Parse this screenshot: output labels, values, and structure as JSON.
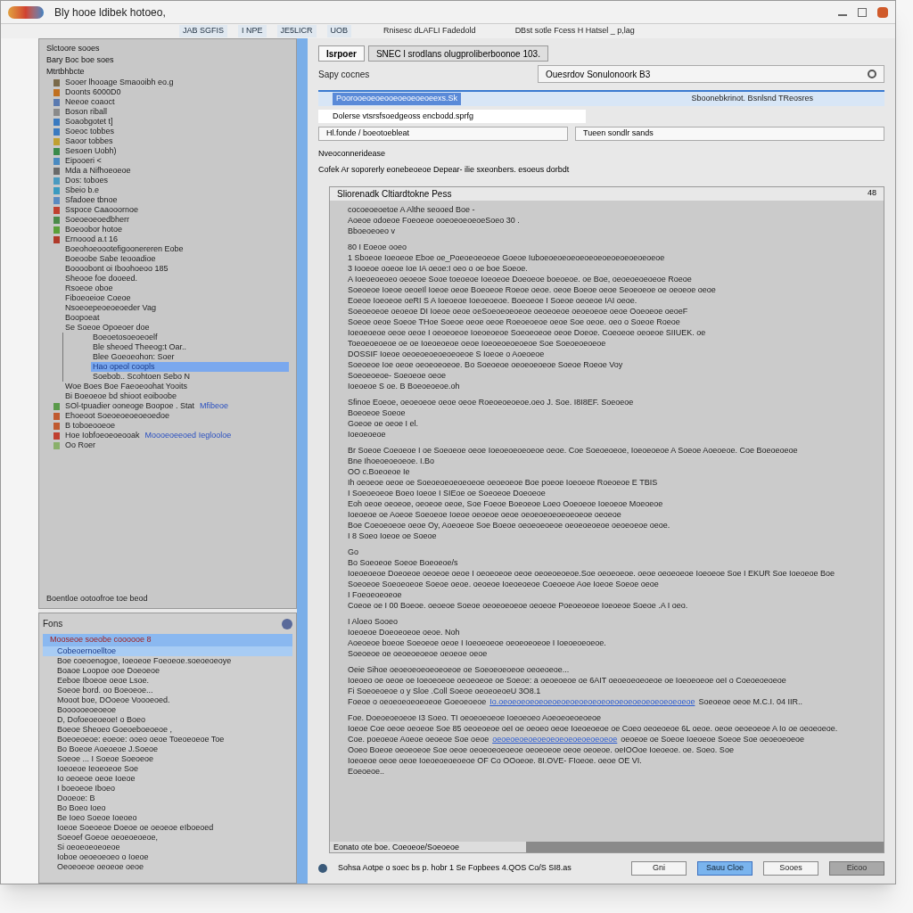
{
  "window": {
    "title": "Bly hooe ldibek hotoeo,"
  },
  "toolbar": {
    "items": [
      "JAB SGFIS",
      "I NPE",
      "JE5LICR",
      "UOB"
    ],
    "center_text": "Rnisesc dLAFLI Fadedold",
    "right_text": "DBst sotle Fcess H Hatsel _ p,lag"
  },
  "left_panel": {
    "header_lines": [
      "Slctoore sooes",
      "Bary Boc boe soes",
      "Mtrtbhbcte"
    ],
    "tree": [
      {
        "label": "Sooer lhooage Smaooibh eo.g",
        "color": "#7a6a4a",
        "selected": false
      },
      {
        "label": "Doonts 6000D0",
        "color": "#c07020",
        "selected": false
      },
      {
        "label": "Neeoe coaoct",
        "color": "#5a7ab0",
        "selected": false
      },
      {
        "label": "Boson riball",
        "color": "#8a8a8a",
        "selected": false
      },
      {
        "label": "Soaobgotet t]",
        "color": "#3a7ac0",
        "selected": false
      },
      {
        "label": "Soeoc tobbes",
        "color": "#3a7ac0",
        "selected": false
      },
      {
        "label": "Saoor tobbes",
        "color": "#c0a030",
        "selected": false
      },
      {
        "label": "Sesoen Uobh)",
        "color": "#3a8a4a",
        "selected": false
      },
      {
        "label": "Eipooeri <",
        "color": "#4a8ac0",
        "selected": false
      },
      {
        "label": "Mda a Nifhoeoeoe",
        "color": "#6a6a6a",
        "selected": false
      },
      {
        "label": "Dos: toboes",
        "color": "#4a9ac0",
        "selected": false
      },
      {
        "label": "Sbeio b.e",
        "color": "#3a9ac0",
        "selected": false
      },
      {
        "label": "Sfadoee tbnoe",
        "color": "#5a8ac0",
        "selected": false
      },
      {
        "label": "Sspoce Caaooornoe",
        "color": "#c04030",
        "selected": false
      },
      {
        "label": "Soeoeoeoedbherr",
        "color": "#4a8a4a",
        "selected": false
      },
      {
        "label": "Boeoobor hotoe",
        "color": "#5aa03a",
        "selected": false
      },
      {
        "label": "Ernoood a.t 16",
        "color": "#b03a2a",
        "selected": false
      },
      {
        "label": "Boeohoeoootefigoonereren Eobe",
        "selected": false
      },
      {
        "label": "Boeoobe Sabe Ieooadioe",
        "selected": false
      },
      {
        "label": "Boooobont oi Iboohoeoo 185",
        "selected": false
      },
      {
        "label": "Sheooe foe dooeed.",
        "selected": false
      },
      {
        "label": "Rsoeoe oboe",
        "selected": false
      },
      {
        "label": "Fiboeoeioe Coeoe",
        "selected": false
      },
      {
        "label": "Nsoeoepeoeoeoeder Vag",
        "selected": false
      },
      {
        "label": "Boopoeat",
        "selected": false
      },
      {
        "label": "Se Soeoe Opoeoer doe",
        "selected": false,
        "children": [
          {
            "label": "Boeoetosoeoeoelf",
            "selected": false
          },
          {
            "label": "Ble sheoed Theeog:t Oar..",
            "selected": false
          },
          {
            "label": "Blee Goeoeohon: Soer",
            "selected": false
          },
          {
            "label": "Hao opeol coopls",
            "selected": true
          },
          {
            "label": "Soebob.. Scohtoen Sebo N",
            "selected": false
          }
        ]
      },
      {
        "label": "Woe Boes Boe Faeoeoohat Yooits",
        "selected": false
      },
      {
        "label": "Bi Boeoeoe bd shioot eoiboobe",
        "selected": false
      },
      {
        "label": "SOl-tpuadier ooneoge Boopoe . Stat",
        "link": "Mfibeoe",
        "color": "#5a9a4a",
        "selected": false
      },
      {
        "label": "Ehoeoot Soeoeoeoeoeoedoe",
        "color": "#c05a30",
        "selected": false
      },
      {
        "label": "B toboeooeoe",
        "color": "#c05a30",
        "selected": false
      },
      {
        "label": "Hoe Iobfoeoeoeooak",
        "link": "Moooeoeeoed Ieglooloe",
        "color": "#c04030",
        "selected": false
      },
      {
        "label": "Oo Roer",
        "color": "#8ab06a",
        "selected": false
      }
    ],
    "footer": "Boentloe ootoofroe toe beod"
  },
  "bottom_panel": {
    "title": "Fons",
    "path": "Mooseoe soeobe coooooe 8",
    "items": [
      {
        "label": "Cobeoernoelltoe",
        "selected": true
      },
      {
        "label": "Boe coeoenogoe, Ioeoeoe Foeoeoe.soeoeoeoye",
        "selected": false
      },
      {
        "label": "Boaoe Loopoe ooe Doeoeoe",
        "selected": false
      },
      {
        "label": "Eeboe Iboeoe oeoe Lsoe.",
        "selected": false
      },
      {
        "label": "Soeoe bord. oo Boeoeoe...",
        "selected": false
      },
      {
        "label": "Mooot boe, DOoeoe Voooeoed.",
        "selected": false
      },
      {
        "label": "Boooooeoeoeoe",
        "selected": false
      },
      {
        "label": "D, Dofoeoeoeoe! o Boeo",
        "selected": false
      },
      {
        "label": "Boeoe Sheoeo Goeoeboeoeoe ,",
        "selected": false
      },
      {
        "label": "Boeoeoeoe: eoeoe: ooeo oeoe Toeoeoeoe Toe",
        "selected": false
      },
      {
        "label": "Bo Boeoe Aoeoeoe J.Soeoe",
        "selected": false
      },
      {
        "label": "Soeoe ... I Soeoe Soeoeoe",
        "selected": false
      },
      {
        "label": "Ioeoeoe Ieoeoeoe Soe",
        "selected": false
      },
      {
        "label": "Io oeoeoe oeoe Ioeoe",
        "selected": false
      },
      {
        "label": "I boeoeoe Iboeo",
        "selected": false
      },
      {
        "label": "Dooeoe: B",
        "selected": false
      },
      {
        "label": "Bo Boeo Ioeo",
        "selected": false
      },
      {
        "label": "Be Ioeo Soeoe Ioeoeo",
        "selected": false
      },
      {
        "label": "Ioeoe Soeoeoe Doeoe oe oeoeoe   eIboeoed",
        "selected": false
      },
      {
        "label": "Soeoef Goeoe oeoeoeoeoe,",
        "selected": false
      },
      {
        "label": "Si oeoeoeoeoeoe",
        "selected": false
      },
      {
        "label": "Ioboe oeoeoeoeo o Ioeoe",
        "selected": false
      },
      {
        "label": "Oeoeoeoe oeoeoe oeoe",
        "selected": false
      }
    ]
  },
  "main": {
    "tabs": [
      {
        "label": "Isrpoer",
        "selected": true
      },
      {
        "label": "SNEC l srodlans olugproliberboonoe 103.",
        "selected": false
      }
    ],
    "subtitle": "Sapy cocnes",
    "search": {
      "value": "Ouesrdov Sonulonoork B3"
    },
    "header_bar": {
      "left": "Poorooeoeoeooeoeoeoeoeexs.Sk",
      "right": "Sboonebkrinot. Bsnlsnd TReosres"
    },
    "info_row": "Dolerse vtsrsfsoedgeoss encbodd.sprfg",
    "path_field": {
      "value": "Hl.fonde / boeotoebleat"
    },
    "combo": {
      "value": "Tueen sondlr sands"
    },
    "note": "Nveoconneridease",
    "description": "Cofek Ar soporerly eonebeoeoe Depear- ilie sxeonbers. esoeus dorbdt",
    "content": {
      "title": "Sliorenadk Cltiardtokne Pess",
      "corner": "48",
      "blocks": [
        {
          "lines": [
            {
              "text": "cocoeoeoetoe A Althe seooed Boe -"
            },
            {
              "text": "Aoeoe odoeoe Foeoeoe ooeoeoeoeoeSoeo 30 ."
            },
            {
              "text": "Bboeoeoeo v"
            }
          ]
        },
        {
          "lines": [
            {
              "text": "80 I Eoeoe ooeo"
            },
            {
              "text": "1 Sboeoe Ioeoeoe Eboe oe_Poeoeoeoeoe Goeoe Iuboeoeoeoeoeoeoeoeoeoeoeoeoeoe"
            },
            {
              "text": "3 Iooeoe ooeoe Ioe IA oeoe:I oeo o oe boe Soeoe."
            },
            {
              "text": "A Ioeoeoeoeo oeoeoe Sooe toeoeoe Ioeoeoe Doeoeoe boeoeoe. oe Boe, oeoeoeoeoeoe Roeoe"
            },
            {
              "text": "Soeoeoe Ioeoe oeoeIl Ioeoe oeoe Boeoeoe Roeoe oeoe. oeoe Boeoe oeoe Seoeoeoe oe oeoeoe oeoe"
            },
            {
              "text": "Eoeoe Ioeoeoe oeRI S A Ioeoeoe Ioeoeoeoe. Boeoeoe I Soeoe oeoeoe IAI oeoe."
            },
            {
              "text": "Soeoeoeoe oeoeoe DI Ioeoe oeoe oeSoeoeoeoeoe oeoeoeoe oeoeoeoe oeoe Ooeoeoe oeoeF"
            },
            {
              "text": "Soeoe oeoe Soeoe THoe Soeoe oeoe oeoe Roeoeoeoe oeoe Soe oeoe. oeo o Soeoe Roeoe"
            },
            {
              "text": "Ioeoeoeoe oeoe oeoe I oeoeoeoe Ioeoeoeoe Soeoeoeoe oeoe Doeoe. Coeoeoe oeoeoe SIIUEK. oe"
            },
            {
              "text": "Toeoeoeoeoe oe oe Ioeoeoeoe oeoe Ioeoeoeoeoeoe Soe Soeoeoeoeoe"
            },
            {
              "text": "DOSSIF Ioeoe oeoeoeoeoeoeoeoe S Ioeoe o Aoeoeoe"
            },
            {
              "text": "Soeoeoe Ioe oeoe oeoeoeoeoe. Bo Soeoeoe oeoeoeoeoe Soeoe Roeoe Voy"
            },
            {
              "text": "Soeoeoeoe- Soeoeoe oeoe"
            },
            {
              "text": "Ioeoeoe S oe. B Boeoeoeoe.oh"
            }
          ]
        },
        {
          "lines": [
            {
              "text": "Sfinoe Eoeoe, oeoeoeoe oeoe oeoe Roeoeoeoeoe.oeo J. Soe. I8I8EF. Soeoeoe"
            },
            {
              "text": "Boeoeoe Soeoe"
            },
            {
              "text": "Goeoe oe oeoe I el."
            },
            {
              "text": "Ioeoeoeoe"
            }
          ]
        },
        {
          "lines": [
            {
              "text": "Br Soeoe Coeoeoe I oe  Soeoeoe oeoe Ioeoeoeoeoeoe oeoe. Coe Soeoeoeoe, Ioeoeoeoe A Soeoe  Aoeoeoe. Coe Boeoeoeoe"
            },
            {
              "text": "Bne Ihoeoeoeoeoe. I.Bo"
            },
            {
              "text": "OO c.Boeoeoe Ie"
            },
            {
              "text": "Ih oeoeoe oeoe oe Soeoeoeoeoeoeoe oeoeoeoe Boe poeoe Ioeoeoe Roeoeoe E TBIS"
            },
            {
              "text": "I Soeoeoeoe Boeo Ioeoe I SIEoe oe Soeoeoe Doeoeoe"
            },
            {
              "text": "Eoh oeoe oeoeoe, oeoeoe oeoe,       Soe Foeoe Boeoeoe Loeo Ooeoeoe Ioeoeoe Moeoeoe"
            },
            {
              "text": "Ioeoeoe oe Aoeoe Soeoeoe Ioeoe oeoeoe oeoe oeoeoeoeoeoeoeoe oeoeoe"
            },
            {
              "text": "Boe Coeoeoeoe oeoe Oy, Aoeoeoe Soe Boeoe oeoeoeoeoe oeoeoeoeoe oeoeoeoe oeoe."
            },
            {
              "text": "I 8 Soeo Ioeoe oe Soeoe"
            }
          ]
        },
        {
          "lines": [
            {
              "text": "Go"
            },
            {
              "text": "Bo Soeoeoe Soeoe Boeoeoe/s"
            },
            {
              "text": "Ioeoeoeoe Doeoeoe oeoeoe oeoe I oeoeoeoe oeoe oeoeoeoeoe.Soe oeoeoeoe. oeoe oeoeoeoe Ioeoeoe Soe I EKUR Soe Ioeoeoe Boe"
            },
            {
              "text": "Soeoeoe Soeoeoeoe Soeoe oeoe. oeoeoe Ioeoeoeoe  Coeoeoe Aoe Ioeoe Soeoe oeoe"
            },
            {
              "text": "I Foeoeoeoeoe"
            },
            {
              "text": "Coeoe oe I 00  Boeoe. oeoeoe Soeoe oeoeoeoeoe oeoeoe Poeoeoeoe Ioeoeoe Soeoe .A I oeo."
            }
          ]
        },
        {
          "lines": [
            {
              "text": "I Aloeo Sooeo"
            },
            {
              "text": "Ioeoeoe Doeoeoeoe oeoe. Noh"
            },
            {
              "text": "Aoeoeoe boeoe Soeoeoe oeoe I Ioeoeoeoe oeoeoeoeoe I Ioeoeoeoeoe."
            },
            {
              "text": "Soeoeoe oe oeoeoeoeoe oeoeoe oeoe"
            }
          ]
        },
        {
          "lines": [
            {
              "text": "Oeie Sihoe oeoeoeoeoeoeoeoe oe Soeoeoeoeoe oeoeoeoe..."
            },
            {
              "text": "Ioeoeo oe oeoe oe Ioeoeoeoe oeoeoeoe oe Soeoe: a oeoeoeoe oe 6AIT oeoeoeoeoeoe oe Ioeoeoeoe oeI o Coeoeoeoeoe"
            },
            {
              "text": "Fi Soeoeoeoe o                                                y Sloe .Coll Soeoe oeoeoeoeU 3O8.1"
            },
            {
              "text": "Foeoe o oeoeoeoeoeoeoe Goeoeoeoe",
              "link": "Io.oeoeoeoeoeoeoeoeoeoeoeoeoeoeoeoeoeoeoeoeoeoe",
              "after": "Soeoeoe oeoe M.C.I. 04 IIR.."
            }
          ]
        },
        {
          "lines": [
            {
              "text": "Foe. Doeoeoeoeoe I3 Soeo. TI oeoeoeoeoe Ioeoeoeo Aoeoeoeoeoeoe"
            },
            {
              "text": "Ioeoe Coe oeoe oeoeoe Soe 85 oeoeoeoe oeI oe oeoeo oeoe Ioeoeoeoe oe Coeo oeoeoeoe 6L oeoe. oeoe oeoeoeoe A Io oe oeoeoeoe."
            },
            {
              "text": "Coe. poeoeoe Aoeoe oeoeoe Soe oeoe",
              "link": "oeoeoeoeoeoeoeoeoeoeoeoeoeoe",
              "after": "oeoeoe oe Soeoe Ioeoeoe Soeoe Soe oeoeoeoeoe"
            },
            {
              "text": "Ooeo Boeoe oeoeoeoe Soe oeoe oeoeoeoeoeoe oeoeoeoe oeoe oeoeoe. oeIOOoe Ioeoeoe. oe. Soeo. Soe"
            },
            {
              "text": "Ioeoeoe oeoe oeoe Ioeoeoeoeoeoe OF Co OOoeoe. 8I.OVE- FIoeoe. oeoe OE VI."
            },
            {
              "text": "Eoeoeoe.."
            }
          ]
        }
      ]
    },
    "scroll_label": "Eonato ote boe. Coeoeoe/Soeoeoe",
    "status": "Sohsa Aotpe o soec bs p. hobr 1 Se Fopbees 4.QOS Co/S SI8.as",
    "buttons": [
      {
        "label": "Gni",
        "kind": "default"
      },
      {
        "label": "Sauu Cloe",
        "kind": "primary"
      },
      {
        "label": "Sooes",
        "kind": "default"
      },
      {
        "label": "Eicoo",
        "kind": "dark"
      }
    ]
  }
}
